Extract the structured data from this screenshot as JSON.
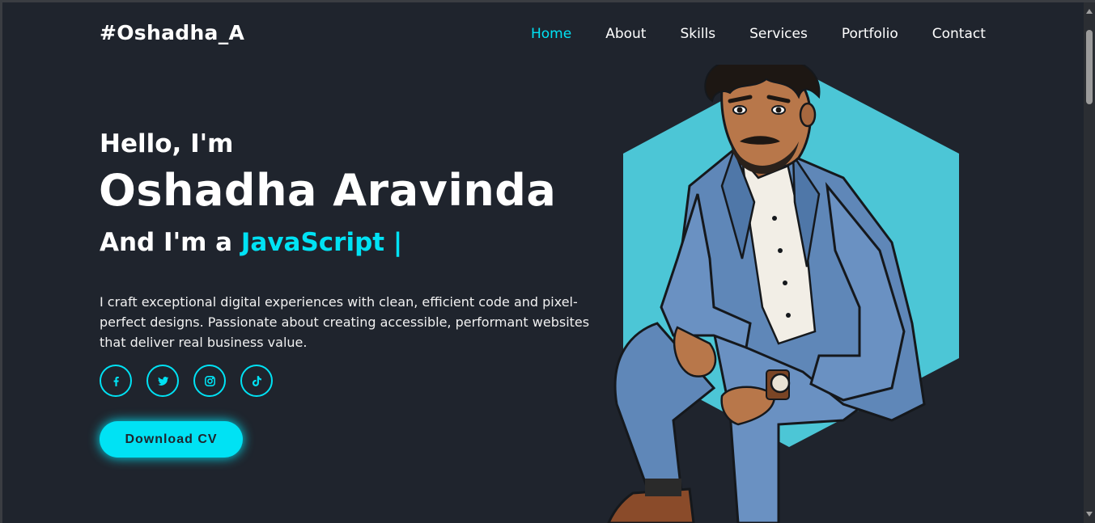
{
  "logo": "#Oshadha_A",
  "nav": {
    "items": [
      {
        "label": "Home",
        "active": true
      },
      {
        "label": "About"
      },
      {
        "label": "Skills"
      },
      {
        "label": "Services"
      },
      {
        "label": "Portfolio"
      },
      {
        "label": "Contact"
      }
    ]
  },
  "hero": {
    "greeting": "Hello, I'm",
    "name": "Oshadha Aravinda",
    "role_prefix": "And I'm a ",
    "role_typed": "JavaScript |",
    "bio": "I craft exceptional digital experiences with clean, efficient code and pixel-perfect designs. Passionate about creating accessible, performant websites that deliver real business value.",
    "socials": [
      {
        "icon": "facebook-icon"
      },
      {
        "icon": "twitter-icon"
      },
      {
        "icon": "instagram-icon"
      },
      {
        "icon": "tiktok-icon"
      }
    ],
    "cv_button": "Download CV"
  },
  "colors": {
    "background": "#1f242d",
    "accent": "#00e2f4",
    "text": "#ffffff",
    "hexagon": "#4cc6d6",
    "suit": "#5f87b8"
  }
}
